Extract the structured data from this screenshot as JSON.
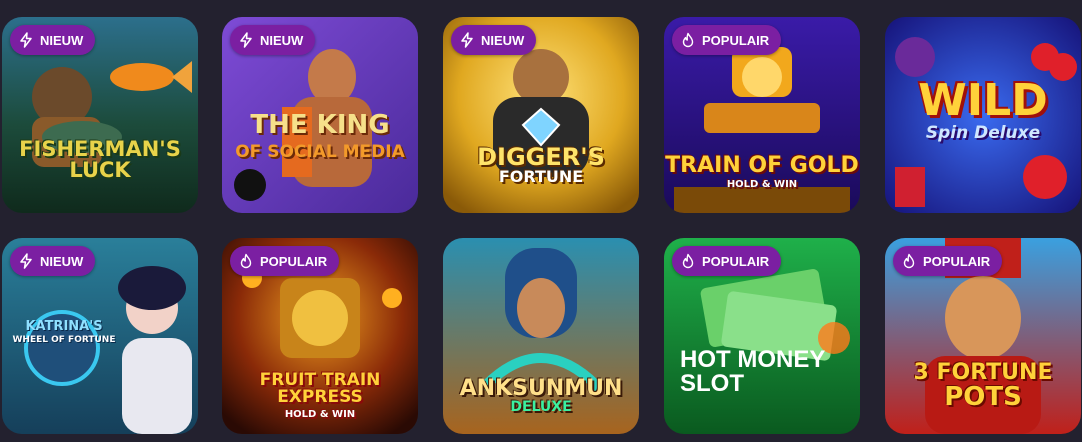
{
  "colors": {
    "page_background": "#23212f",
    "badge_background": "#7b1fa2",
    "badge_text": "#ffffff"
  },
  "badge_icons": {
    "NIEUW": "lightning-icon",
    "POPULAIR": "flame-icon"
  },
  "games": [
    {
      "badge": "NIEUW",
      "badge_icon": "lightning-icon",
      "title_line1": "Fisherman's",
      "title_line2": "Luck"
    },
    {
      "badge": "NIEUW",
      "badge_icon": "lightning-icon",
      "title_line1": "The King",
      "title_line2": "of Social Media"
    },
    {
      "badge": "NIEUW",
      "badge_icon": "lightning-icon",
      "title_line1": "Digger's",
      "title_line2": "Fortune"
    },
    {
      "badge": "POPULAIR",
      "badge_icon": "flame-icon",
      "title_line1": "Train of Gold",
      "title_line2": "Hold & Win"
    },
    {
      "badge": "",
      "badge_icon": "",
      "title_line1": "Wild",
      "title_line2": "Spin Deluxe"
    },
    {
      "badge": "NIEUW",
      "badge_icon": "lightning-icon",
      "title_line1": "Katrina's",
      "title_line2": "Wheel of Fortune"
    },
    {
      "badge": "POPULAIR",
      "badge_icon": "flame-icon",
      "title_line1": "Fruit Train Express",
      "title_line2": "Hold & Win"
    },
    {
      "badge": "",
      "badge_icon": "",
      "title_line1": "Anksunmun",
      "title_line2": "Deluxe"
    },
    {
      "badge": "POPULAIR",
      "badge_icon": "flame-icon",
      "title_line1": "Hot Money",
      "title_line2": "Slot"
    },
    {
      "badge": "POPULAIR",
      "badge_icon": "flame-icon",
      "title_line1": "3 Fortune",
      "title_line2": "Pots"
    }
  ]
}
